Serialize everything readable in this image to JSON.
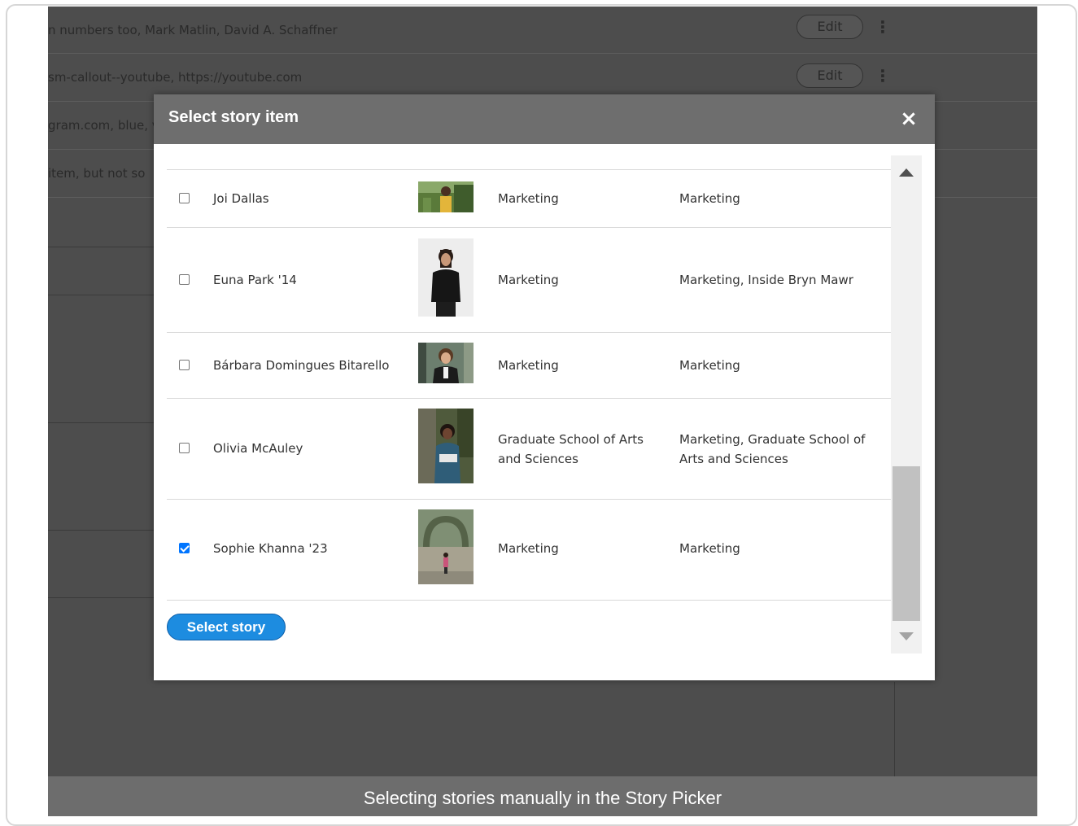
{
  "background": {
    "rows": [
      {
        "text": "n numbers too, Mark Matlin, David A. Schaffner",
        "edit": "Edit",
        "kebab": "⋮"
      },
      {
        "text": "sm-callout--youtube, https://youtube.com",
        "edit": "Edit",
        "kebab": "⋮"
      },
      {
        "text": "gram.com, blue, v"
      },
      {
        "text": "item, but not so"
      }
    ]
  },
  "modal": {
    "title": "Select story item",
    "close": "×",
    "rows": [
      {
        "name": "Joi Dallas",
        "category": "Marketing",
        "tags": "Marketing",
        "checked": false
      },
      {
        "name": "Euna Park '14",
        "category": "Marketing",
        "tags": "Marketing, Inside Bryn Mawr",
        "checked": false
      },
      {
        "name": "Bárbara Domingues Bitarello",
        "category": "Marketing",
        "tags": "Marketing",
        "checked": false
      },
      {
        "name": "Olivia McAuley",
        "category": "Graduate School of Arts and Sciences",
        "tags": "Marketing, Graduate School of Arts and Sciences",
        "checked": false
      },
      {
        "name": "Sophie Khanna '23",
        "category": "Marketing",
        "tags": "Marketing",
        "checked": true
      }
    ],
    "select_button": "Select story"
  },
  "caption": "Selecting stories manually in the Story Picker",
  "colors": {
    "accent": "#1d8ce0",
    "header": "#6e6e6e",
    "overlay": "#4d4d4d"
  }
}
